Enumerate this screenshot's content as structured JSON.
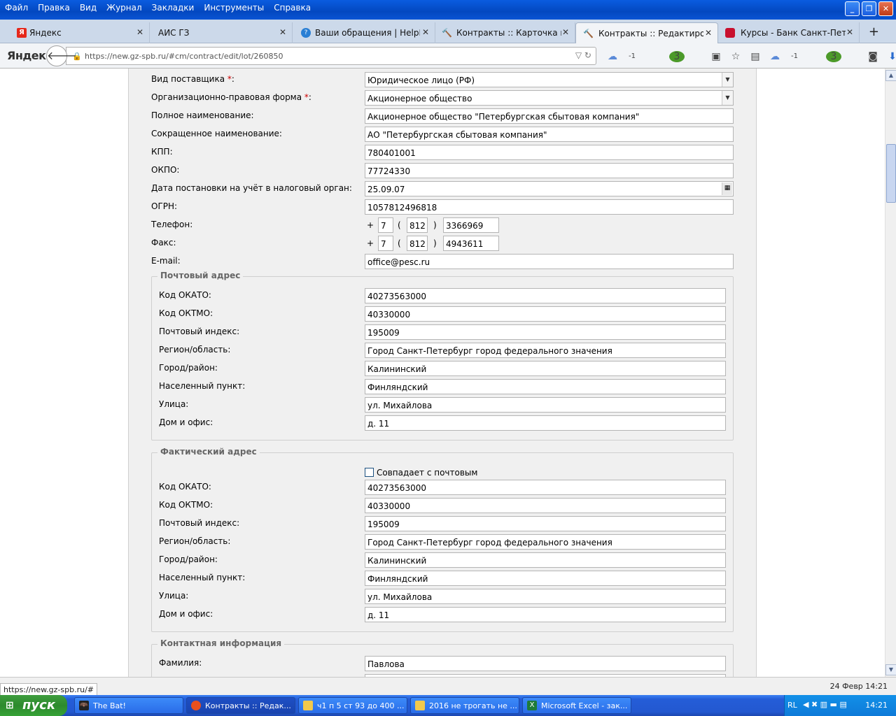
{
  "menu": [
    "Файл",
    "Правка",
    "Вид",
    "Журнал",
    "Закладки",
    "Инструменты",
    "Справка"
  ],
  "tabs": [
    {
      "label": "Яндекс",
      "color": "#e6281b"
    },
    {
      "label": "АИС ГЗ",
      "color": "#ccd9ea"
    },
    {
      "label": "Ваши обращения | HelpDes...",
      "color": "#2a7fd4"
    },
    {
      "label": "Контракты :: Карточка ко...",
      "color": "#556b8a"
    },
    {
      "label": "Контракты :: Редактиров...",
      "color": "#556b8a"
    },
    {
      "label": "Курсы - Банк Санкт-Петер...",
      "color": "#c8102e"
    }
  ],
  "nav": {
    "logo": "Яндекс",
    "url": "https://new.gz-spb.ru/#cm/contract/edit/lot/260850",
    "cloud1": "-1",
    "badge1": "3",
    "cloud2": "-1",
    "badge2": "3"
  },
  "form": {
    "supplier_type": {
      "label": "Вид поставщика",
      "value": "Юридическое лицо (РФ)"
    },
    "org_form": {
      "label": "Организационно-правовая форма",
      "value": "Акционерное общество"
    },
    "full_name": {
      "label": "Полное наименование:",
      "value": "Акционерное общество \"Петербургская сбытовая компания\""
    },
    "short_name": {
      "label": "Сокращенное наименование:",
      "value": "АО \"Петербургская сбытовая компания\""
    },
    "kpp": {
      "label": "КПП:",
      "value": "780401001"
    },
    "okpo": {
      "label": "ОКПО:",
      "value": "77724330"
    },
    "reg_date": {
      "label": "Дата постановки на учёт в налоговый орган:",
      "value": "25.09.07"
    },
    "ogrn": {
      "label": "ОГРН:",
      "value": "1057812496818"
    },
    "phone": {
      "label": "Телефон:",
      "country": "7",
      "code": "812",
      "number": "3366969"
    },
    "fax": {
      "label": "Факс:",
      "country": "7",
      "code": "812",
      "number": "4943611"
    },
    "email": {
      "label": "E-mail:",
      "value": "office@pesc.ru"
    },
    "plus": "+",
    "lparen": "(",
    "rparen": ")",
    "colon_star": ":"
  },
  "postal": {
    "legend": "Почтовый адрес",
    "fields": [
      {
        "label": "Код ОКАТО:",
        "value": "40273563000"
      },
      {
        "label": "Код ОКТМО:",
        "value": "40330000"
      },
      {
        "label": "Почтовый индекс:",
        "value": "195009"
      },
      {
        "label": "Регион/область:",
        "value": "Город Санкт-Петербург город федерального значения"
      },
      {
        "label": "Город/район:",
        "value": "Калининский"
      },
      {
        "label": "Населенный пункт:",
        "value": "Финляндский"
      },
      {
        "label": "Улица:",
        "value": "ул. Михайлова"
      },
      {
        "label": "Дом и офис:",
        "value": "д. 11"
      }
    ]
  },
  "actual": {
    "legend": "Фактический адрес",
    "same_as_postal": "Совпадает с почтовым",
    "fields": [
      {
        "label": "Код ОКАТО:",
        "value": "40273563000"
      },
      {
        "label": "Код ОКТМО:",
        "value": "40330000"
      },
      {
        "label": "Почтовый индекс:",
        "value": "195009"
      },
      {
        "label": "Регион/область:",
        "value": "Город Санкт-Петербург город федерального значения"
      },
      {
        "label": "Город/район:",
        "value": "Калининский"
      },
      {
        "label": "Населенный пункт:",
        "value": "Финляндский"
      },
      {
        "label": "Улица:",
        "value": "ул. Михайлова"
      },
      {
        "label": "Дом и офис:",
        "value": "д. 11"
      }
    ]
  },
  "contact": {
    "legend": "Контактная информация",
    "surname": {
      "label": "Фамилия:",
      "value": "Павлова"
    }
  },
  "status": {
    "url": "https://new.gz-spb.ru/#",
    "date": "24 Февр 14:21"
  },
  "taskbar": {
    "start": "пуск",
    "items": [
      {
        "label": "The Bat!"
      },
      {
        "label": "Контракты :: Редак..."
      },
      {
        "label": "ч1 п 5 ст 93 до 400 ..."
      },
      {
        "label": "2016 не трогать не ..."
      },
      {
        "label": "Microsoft Excel - зак..."
      }
    ],
    "lang": "RL",
    "clock": "14:21"
  }
}
